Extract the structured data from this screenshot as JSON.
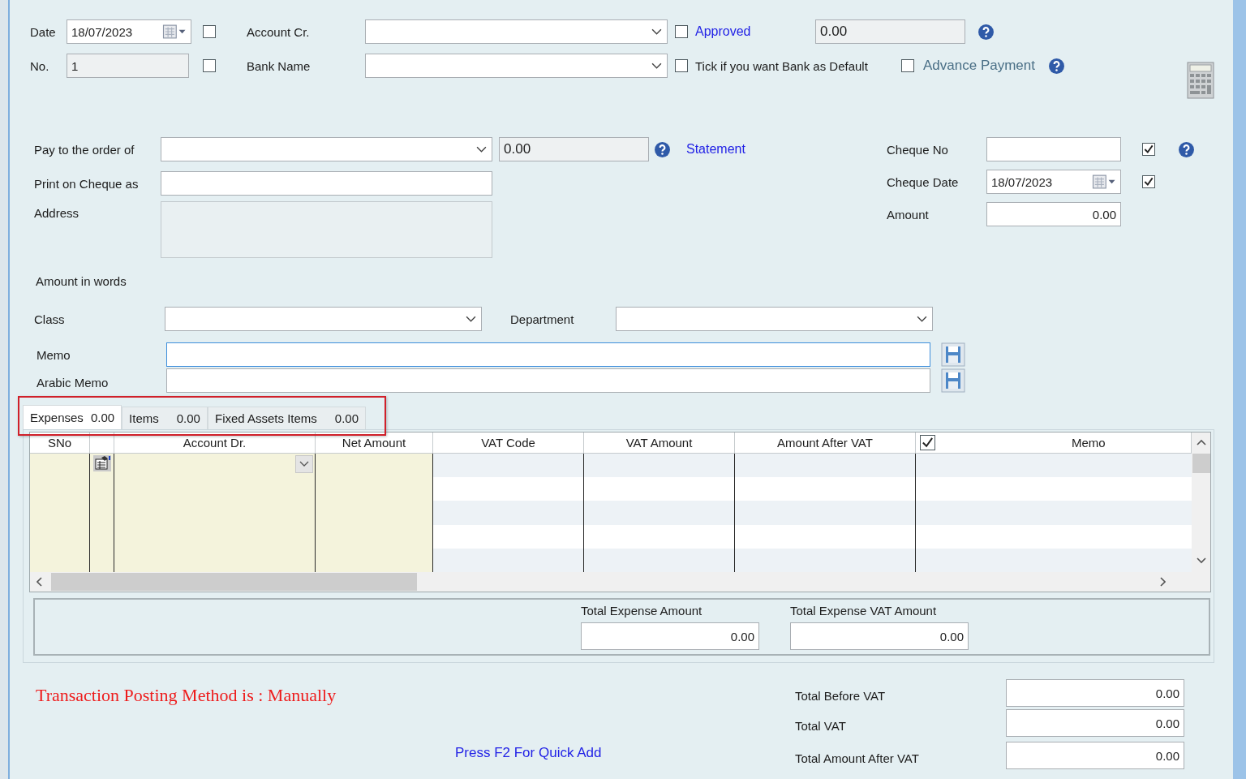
{
  "header": {
    "date": {
      "label": "Date",
      "value": "18/07/2023",
      "checked": false
    },
    "number": {
      "label": "No.",
      "value": "1",
      "checked": false
    },
    "account_cr": {
      "label": "Account Cr."
    },
    "bank_name": {
      "label": "Bank Name"
    },
    "approved": {
      "label": "Approved",
      "checked": false
    },
    "approved_value": "0.00",
    "bank_default": {
      "label": "Tick if you want Bank as Default",
      "checked": false
    },
    "advance_payment": {
      "label": "Advance Payment",
      "checked": false
    }
  },
  "payee": {
    "pay_to_label": "Pay to the order of",
    "balance": "0.00",
    "statement_link": "Statement",
    "print_on_cheque_label": "Print on Cheque as",
    "address_label": "Address",
    "amount_in_words_label": "Amount in words"
  },
  "cheque": {
    "number_label": "Cheque No",
    "number_checked": true,
    "date_label": "Cheque Date",
    "date_value": "18/07/2023",
    "date_checked": true,
    "amount_label": "Amount",
    "amount_value": "0.00"
  },
  "classification": {
    "class_label": "Class",
    "department_label": "Department",
    "memo_label": "Memo",
    "arabic_memo_label": "Arabic Memo"
  },
  "tabs": [
    {
      "label": "Expenses",
      "total": "0.00",
      "selected": true
    },
    {
      "label": "Items",
      "total": "0.00",
      "selected": false
    },
    {
      "label": "Fixed Assets Items",
      "total": "0.00",
      "selected": false
    }
  ],
  "grid": {
    "select_all_checked": true,
    "columns": [
      {
        "label": "SNo",
        "kind": "text",
        "editable": true
      },
      {
        "kind": "icon",
        "editable": true
      },
      {
        "label": "Account Dr.",
        "kind": "combo",
        "editable": true
      },
      {
        "label": "Net Amount",
        "kind": "text",
        "editable": true
      },
      {
        "label": "VAT Code",
        "kind": "text",
        "editable": false
      },
      {
        "label": "VAT Amount",
        "kind": "text",
        "editable": false
      },
      {
        "label": "Amount After VAT",
        "kind": "text",
        "editable": false
      },
      {
        "label": "Memo",
        "kind": "check",
        "editable": false
      }
    ]
  },
  "totals_panel": {
    "expense_label": "Total Expense Amount",
    "expense_value": "0.00",
    "vat_label": "Total Expense VAT Amount",
    "vat_value": "0.00"
  },
  "posting_method": "Transaction Posting Method is : Manually",
  "quick_add_hint": "Press F2 For Quick Add",
  "summary": [
    {
      "label": "Total Before VAT",
      "value": "0.00"
    },
    {
      "label": "Total VAT",
      "value": "0.00"
    },
    {
      "label": "Total Amount After VAT",
      "value": "0.00"
    }
  ]
}
